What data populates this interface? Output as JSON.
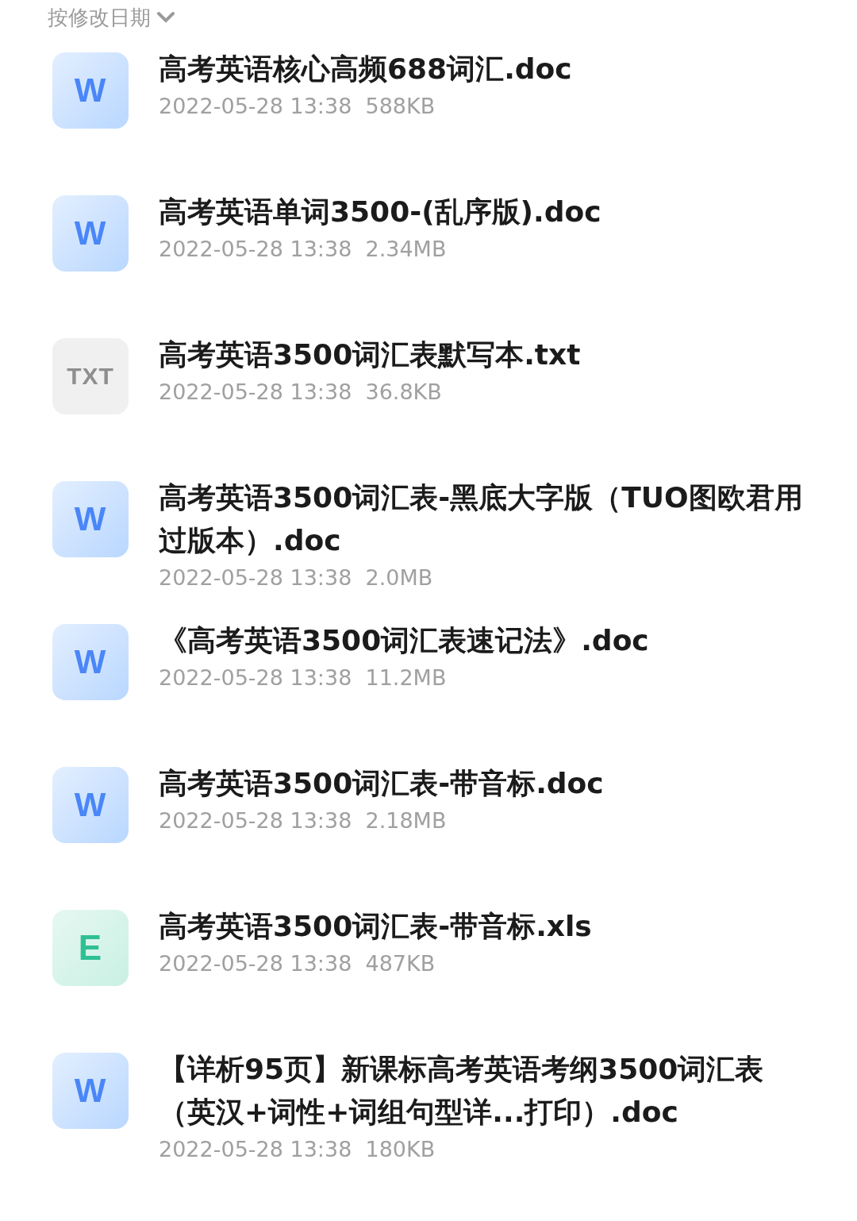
{
  "sort_control": {
    "label": "按修改日期"
  },
  "files": [
    {
      "kind": "doc",
      "icon_label": "W",
      "name": "高考英语核心高频688词汇.doc",
      "date": "2022-05-28 13:38",
      "size": "588KB"
    },
    {
      "kind": "doc",
      "icon_label": "W",
      "name": "高考英语单词3500-(乱序版).doc",
      "date": "2022-05-28 13:38",
      "size": "2.34MB"
    },
    {
      "kind": "txt",
      "icon_label": "TXT",
      "name": "高考英语3500词汇表默写本.txt",
      "date": "2022-05-28 13:38",
      "size": "36.8KB"
    },
    {
      "kind": "doc",
      "icon_label": "W",
      "name": "高考英语3500词汇表-黑底大字版（TUO图欧君用过版本）.doc",
      "date": "2022-05-28 13:38",
      "size": "2.0MB"
    },
    {
      "kind": "doc",
      "icon_label": "W",
      "name": "《高考英语3500词汇表速记法》.doc",
      "date": "2022-05-28 13:38",
      "size": "11.2MB"
    },
    {
      "kind": "doc",
      "icon_label": "W",
      "name": "高考英语3500词汇表-带音标.doc",
      "date": "2022-05-28 13:38",
      "size": "2.18MB"
    },
    {
      "kind": "xls",
      "icon_label": "E",
      "name": "高考英语3500词汇表-带音标.xls",
      "date": "2022-05-28 13:38",
      "size": "487KB"
    },
    {
      "kind": "doc",
      "icon_label": "W",
      "name": "【详析95页】新课标高考英语考纲3500词汇表（英汉+词性+词组句型详...打印）.doc",
      "date": "2022-05-28 13:38",
      "size": "180KB"
    }
  ]
}
